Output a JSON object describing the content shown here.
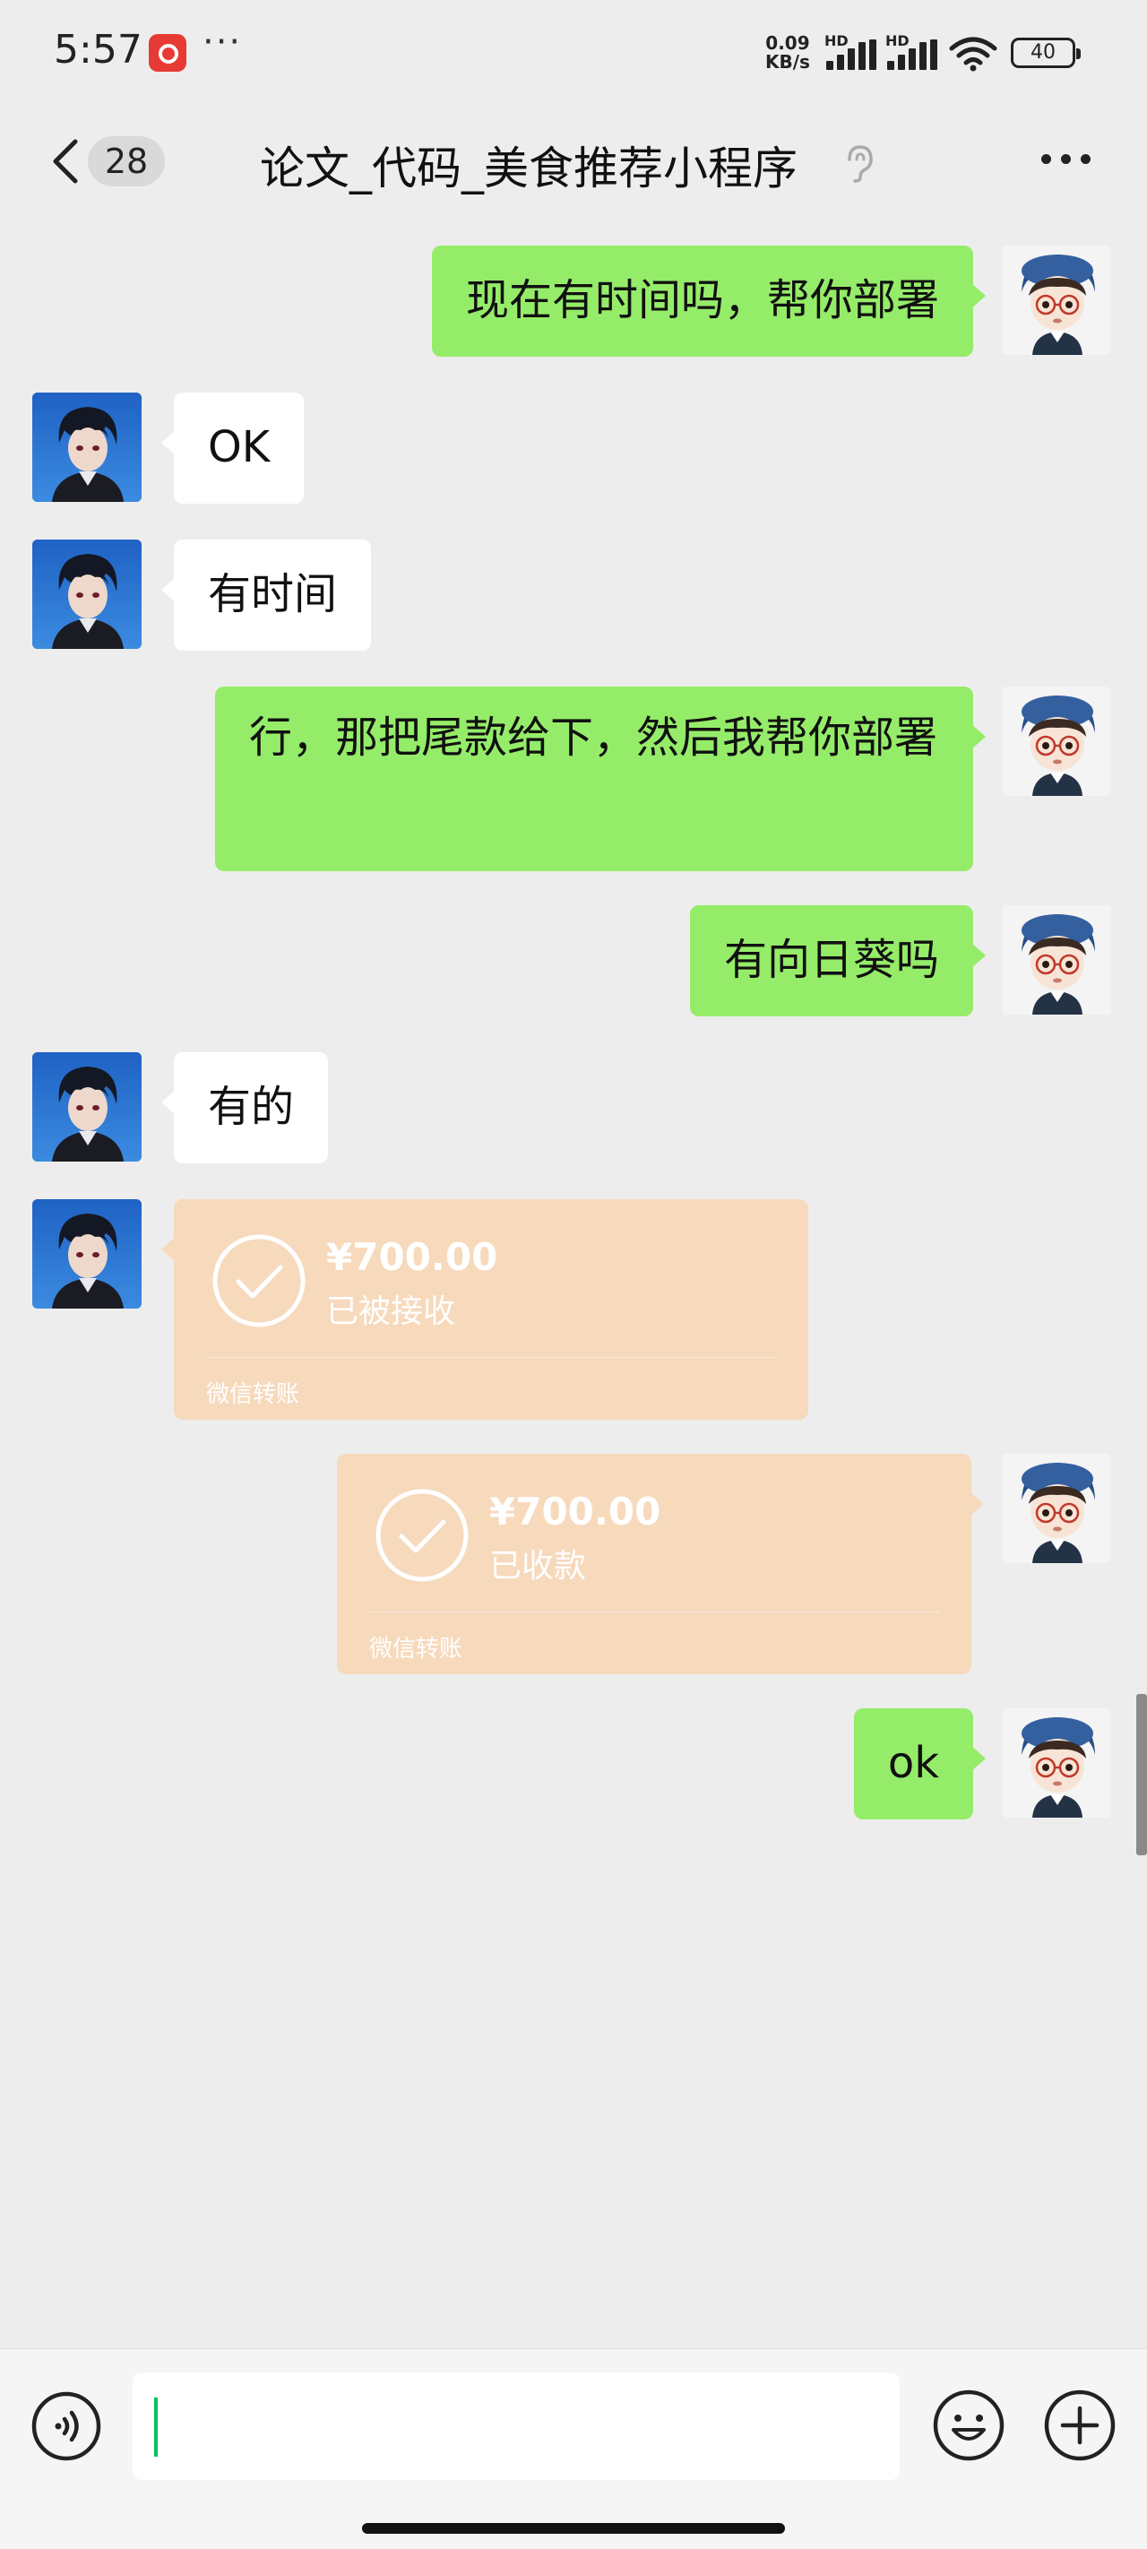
{
  "status_bar": {
    "time": "5:57",
    "dots": "···",
    "net_speed_value": "0.09",
    "net_speed_unit": "KB/s",
    "hd1": "HD",
    "hd2": "HD",
    "battery": "40"
  },
  "header": {
    "unread_count": "28",
    "title": "论文_代码_美食推荐小程序"
  },
  "messages": [
    {
      "side": "right",
      "type": "text",
      "text": "现在有时间吗，帮你部署"
    },
    {
      "side": "left",
      "type": "text",
      "text": "OK"
    },
    {
      "side": "left",
      "type": "text",
      "text": "有时间"
    },
    {
      "side": "right",
      "type": "text",
      "text": "行，那把尾款给下，然后我帮你部署"
    },
    {
      "side": "right",
      "type": "text",
      "text": "有向日葵吗"
    },
    {
      "side": "left",
      "type": "text",
      "text": "有的"
    },
    {
      "side": "left",
      "type": "transfer",
      "amount": "¥700.00",
      "status": "已被接收",
      "footer": "微信转账"
    },
    {
      "side": "right",
      "type": "transfer",
      "amount": "¥700.00",
      "status": "已收款",
      "footer": "微信转账"
    },
    {
      "side": "right",
      "type": "text",
      "text": "ok"
    }
  ],
  "colors": {
    "sent_bubble": "#95ec69",
    "received_bubble": "#ffffff",
    "transfer_bubble": "#f7d9bc",
    "background": "#ededed",
    "caret": "#07c160"
  },
  "icons": {
    "back": "chevron-left-icon",
    "ear": "ear-icon",
    "more": "more-icon",
    "voice": "voice-icon",
    "emoji": "emoji-icon",
    "plus": "plus-icon"
  }
}
